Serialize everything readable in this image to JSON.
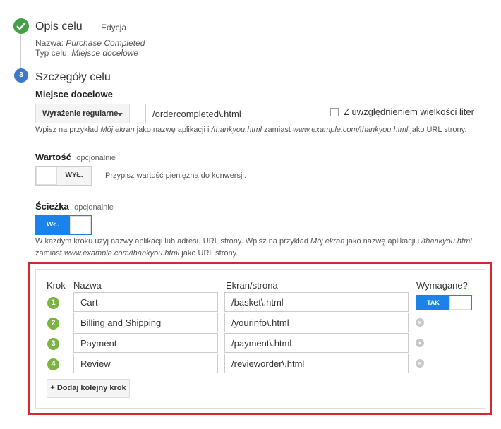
{
  "step1": {
    "title": "Opis celu",
    "edit_link": "Edycja",
    "name_label": "Nazwa:",
    "name_value": "Purchase Completed",
    "type_label": "Typ celu:",
    "type_value": "Miejsce docelowe"
  },
  "step2": {
    "number": "3",
    "title": "Szczegóły celu",
    "destination": {
      "label": "Miejsce docelowe",
      "match_type": "Wyrażenie regularne",
      "value": "/ordercompleted\\.html",
      "case_sensitive_label": "Z uwzględnieniem wielkości liter",
      "help_parts": [
        "Wpisz na przykład ",
        "Mój ekran",
        " jako nazwę aplikacji i ",
        "/thankyou.html",
        " zamiast ",
        "www.example.com/thankyou.html",
        " jako URL strony."
      ]
    },
    "value_section": {
      "label": "Wartość",
      "optional": "opcjonalnie",
      "toggle_label": "WYŁ.",
      "help": "Przypisz wartość pieniężną do konwersji."
    },
    "funnel": {
      "label": "Ścieżka",
      "optional": "opcjonalnie",
      "toggle_label": "WŁ.",
      "help_line1_parts": [
        "W każdym kroku użyj nazwy aplikacji lub adresu URL strony. Wpisz na przykład ",
        "Mój ekran",
        " jako nazwę aplikacji i ",
        "/thankyou.html"
      ],
      "help_line2_parts": [
        "zamiast ",
        "www.example.com/thankyou.html",
        " jako URL strony."
      ],
      "headers": {
        "step": "Krok",
        "name": "Nazwa",
        "screen": "Ekran/strona",
        "required": "Wymagane?"
      },
      "required_toggle": "TAK",
      "rows": [
        {
          "num": "1",
          "name": "Cart",
          "page": "/basket\\.html"
        },
        {
          "num": "2",
          "name": "Billing and Shipping",
          "page": "/yourinfo\\.html"
        },
        {
          "num": "3",
          "name": "Payment",
          "page": "/payment\\.html"
        },
        {
          "num": "4",
          "name": "Review",
          "page": "/revieworder\\.html"
        }
      ],
      "add_button": "+ Dodaj kolejny krok"
    }
  },
  "colors": {
    "accent": "#1a82e8",
    "check": "#43a047",
    "step_num": "#7cb342",
    "highlight": "#d8262e"
  }
}
